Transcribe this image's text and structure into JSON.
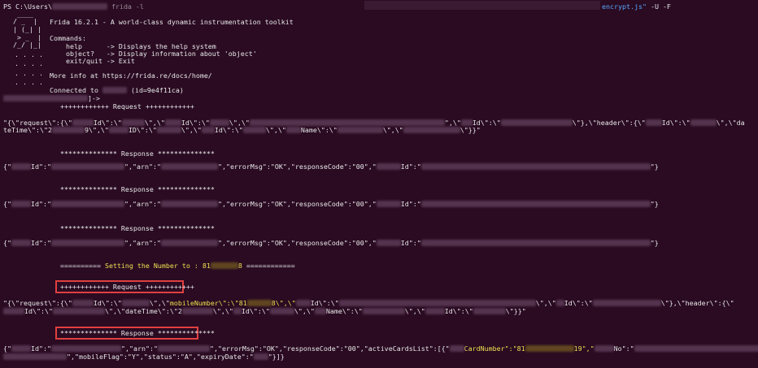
{
  "prompt": {
    "prefix": "PS C:\\Users\\",
    "command": "frida -l",
    "script": "encrypt.js\"",
    "flags": "-U -F"
  },
  "banner": {
    "logo": [
      " ____",
      "/ _  |",
      "| (_| |",
      " > _  |",
      "/_/ |_|",
      ". . . .",
      ". . . .",
      ". . . .",
      ". . . ."
    ],
    "title": "Frida 16.2.1 - A world-class dynamic instrumentation toolkit",
    "commands_header": "Commands:",
    "commands": [
      "    help      -> Displays the help system",
      "    object?   -> Display information about 'object'",
      "    exit/quit -> Exit"
    ],
    "more_info": "More info at https://frida.re/docs/home/",
    "connected_prefix": "Connected to",
    "connected_id": "(id=9e4f11ca)",
    "prompt_suffix": "]->"
  },
  "log": {
    "request_header": "++++++++++++ Request ++++++++++++",
    "response_header": "************** Response **************",
    "req1_a": "\"{\\\"request\\\":{\\\"",
    "req1_b": "Id\\\":\\\"",
    "req1_c": "\\\",\\\"",
    "req1_d": "Id\\\":\\\"",
    "req1_e": "\\\",\\\"",
    "req1_f": "\",\\\"",
    "req1_g": "Id\\\":\\\"",
    "req1_h": "\\\"},\\\"header\\\":{\\\"",
    "req1_i": "Id\\\":\\\"",
    "req1_j": "\\\",\\\"da",
    "req1_line2_a": "teTime\\\":\\\"2",
    "req1_line2_b": "9\\\",\\\"",
    "req1_line2_c": "ID\\\":\\\"",
    "req1_line2_d": "\\\",\\\"",
    "req1_line2_e": "Id\\\":\\\"",
    "req1_line2_f": "\\\",\\\"",
    "req1_line2_g": "Name\\\":\\\"",
    "req1_line2_h": "\\\",\\\"",
    "req1_line2_i": "\\\"}}\"",
    "resp_open": "{\"",
    "resp_id": "Id\":\"",
    "resp_arn": "\",\"arn\":\"",
    "resp_err": "\",\"errorMsg\":\"OK\",\"responseCode\":\"00\",\"",
    "resp_id2": "Id\":\"",
    "resp_close": "\"}",
    "setting_prefix": "========== ",
    "setting_text": "Setting the Number to : 81",
    "setting_end": "8",
    "setting_suffix": " ============",
    "req2_a": "\"{\\\"request\\\":{\\\"",
    "req2_b": "Id\\\":\\\"",
    "req2_c": "\\\",\\\"",
    "req2_mobile": "mobileNumber\\\":\\\"81",
    "req2_mobile_end": "8\\\",\\\"",
    "req2_d": "Id\\\":\\\"",
    "req2_e": "\\\",\\\"",
    "req2_f": "Id\\\":\\\"",
    "req2_g": "\\\"},\\\"header\\\":{\\\"",
    "req2_line2_a": "Id\\\":\\\"",
    "req2_line2_b": "\\\",\\\"dateTime\\\":\\\"2",
    "req2_line2_c": "\\\",\\\"",
    "req2_line2_d": "Id\\\":\\\"",
    "req2_line2_e": "\\\",\\\"",
    "req2_line2_f": "Name\\\":\\\"",
    "req2_line2_g": "\\\",\\\"",
    "req2_line2_h": "Id\\\":\\\"",
    "req2_line2_i": "\\\"}}\"",
    "resp4_err": "\",\"errorMsg\":\"OK\",\"responseCode\":\"00\",\"activeCardsList\":[{\"",
    "resp4_card": "CardNumber\":\"81",
    "resp4_card_end": "19\",\"",
    "resp4_no": "No\":\"",
    "resp4_line2_a": "\",\"mobileFlag\":\"Y\",\"status\":\"A\",\"expiryDate\":\"",
    "resp4_line2_b": "\"}]}"
  },
  "colors": {
    "background": "#2a0b22",
    "highlight": "#f0e050",
    "redbox": "#e04040",
    "link": "#5aa8ff"
  }
}
